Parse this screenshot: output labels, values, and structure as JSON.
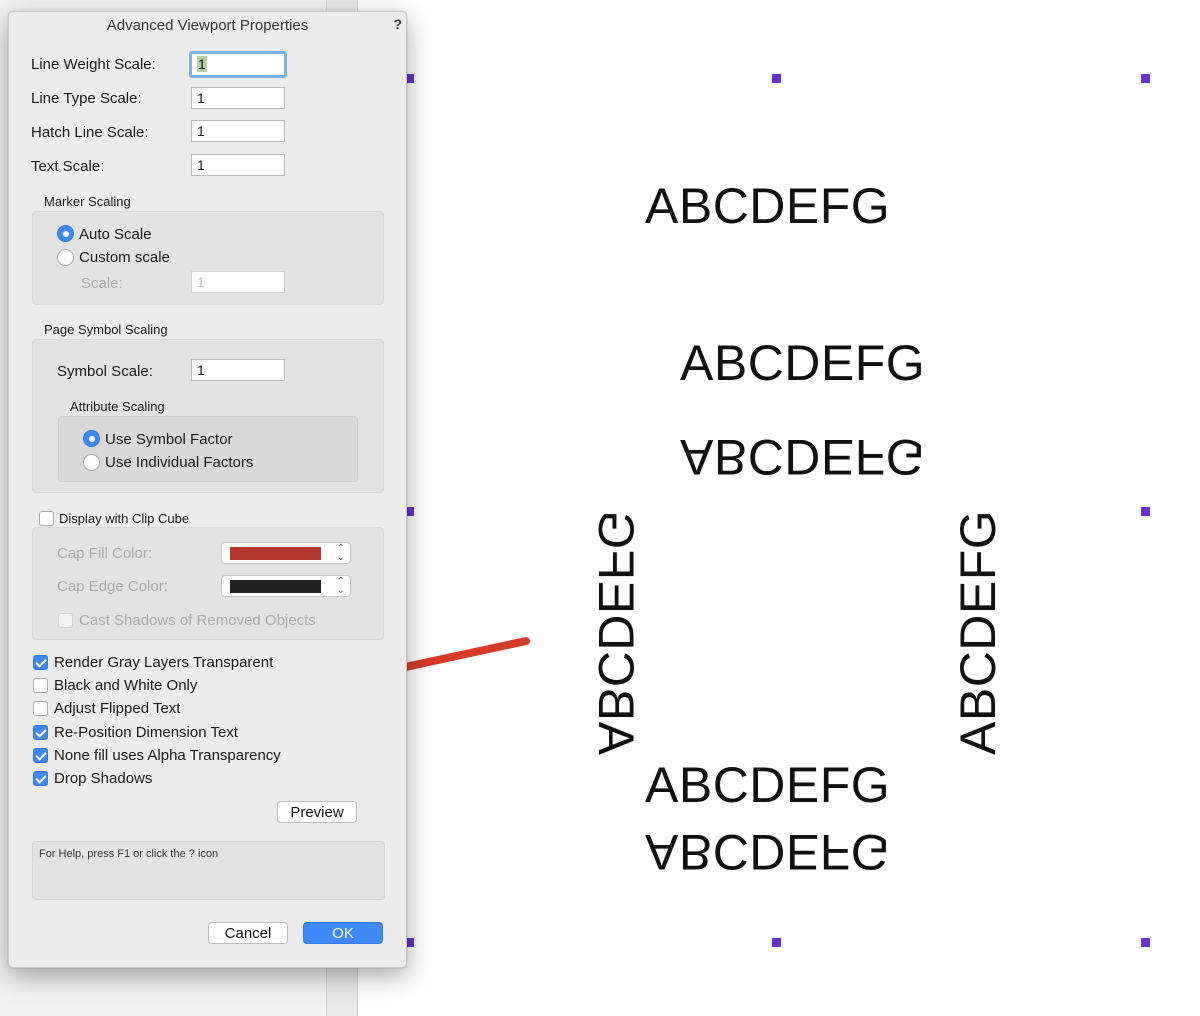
{
  "dialog": {
    "title": "Advanced Viewport Properties",
    "help_icon": "?",
    "fields": {
      "line_weight_scale": {
        "label": "Line Weight Scale:",
        "value": "1"
      },
      "line_type_scale": {
        "label": "Line Type Scale:",
        "value": "1"
      },
      "hatch_line_scale": {
        "label": "Hatch Line Scale:",
        "value": "1"
      },
      "text_scale": {
        "label": "Text Scale:",
        "value": "1"
      }
    },
    "marker_scaling": {
      "label": "Marker Scaling",
      "auto_scale": "Auto Scale",
      "custom_scale": "Custom scale",
      "selected": "Auto Scale",
      "scale_label": "Scale:",
      "scale_value": "1"
    },
    "page_symbol_scaling": {
      "label": "Page Symbol Scaling",
      "symbol_scale_label": "Symbol Scale:",
      "symbol_scale_value": "1",
      "attribute_scaling": {
        "label": "Attribute Scaling",
        "use_symbol_factor": "Use Symbol Factor",
        "use_individual_factors": "Use Individual Factors",
        "selected": "Use Symbol Factor"
      }
    },
    "clip_cube": {
      "label": "Display with Clip Cube",
      "checked": false,
      "cap_fill_label": "Cap Fill Color:",
      "cap_fill_color": "#b5382e",
      "cap_edge_label": "Cap Edge Color:",
      "cap_edge_color": "#222222",
      "cast_shadows_label": "Cast Shadows of Removed Objects"
    },
    "options": [
      {
        "label": "Render Gray Layers Transparent",
        "checked": true
      },
      {
        "label": "Black and White Only",
        "checked": false
      },
      {
        "label": "Adjust Flipped Text",
        "checked": false
      },
      {
        "label": "Re-Position Dimension Text",
        "checked": true
      },
      {
        "label": "None fill uses Alpha Transparency",
        "checked": true
      },
      {
        "label": "Drop Shadows",
        "checked": true
      }
    ],
    "preview_button": "Preview",
    "help_text": "For Help, press F1 or click the ? icon",
    "cancel_button": "Cancel",
    "ok_button": "OK"
  },
  "canvas": {
    "text_top": "ABCDEFG",
    "text_middle_upright": "ABCDEFG",
    "text_middle_flipped": "ABCDEFG",
    "text_left_vertical": "ABCDEFG",
    "text_right_vertical": "ABCDEFG",
    "text_bottom_upright": "ABCDEFG",
    "text_bottom_flipped": "ABCDEFG",
    "handle_color": "#6a2fd0",
    "arrow_color": "#d63b27"
  },
  "colors": {
    "accent": "#3d8af7"
  }
}
